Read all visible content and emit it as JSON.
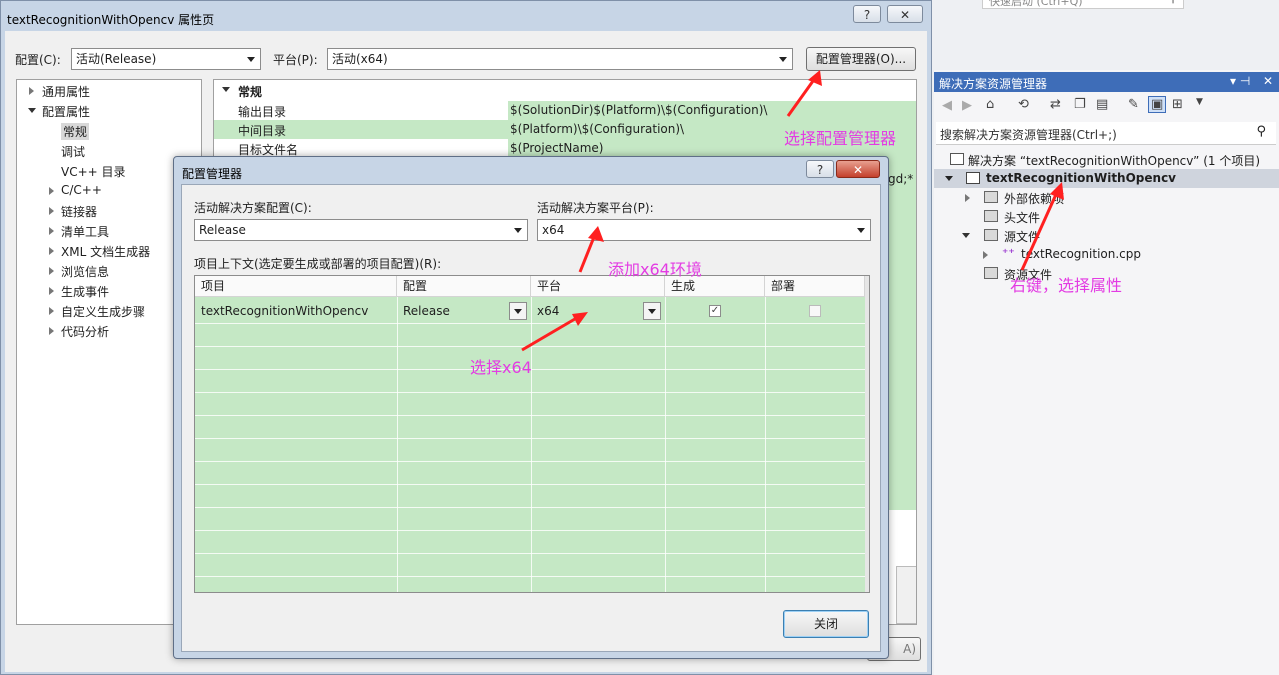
{
  "top_search": {
    "placeholder": "快速启动 (Ctrl+Q)"
  },
  "property_page": {
    "title": "textRecognitionWithOpencv 属性页",
    "help_label": "?",
    "close_label": "✕",
    "config_label": "配置(C):",
    "config_value": "活动(Release)",
    "platform_label": "平台(P):",
    "platform_value": "活动(x64)",
    "config_manager_button": "配置管理器(O)...",
    "bottom_button_partial": "A)",
    "tree": [
      "通用属性",
      "配置属性",
      "常规",
      "调试",
      "VC++ 目录",
      "C/C++",
      "链接器",
      "清单工具",
      "XML 文档生成器",
      "浏览信息",
      "生成事件",
      "自定义生成步骤",
      "代码分析"
    ],
    "section": "常规",
    "rows": [
      {
        "key": "输出目录",
        "value": "$(SolutionDir)$(Platform)\\$(Configuration)\\"
      },
      {
        "key": "中间目录",
        "value": "$(Platform)\\$(Configuration)\\"
      },
      {
        "key": "目标文件名",
        "value": "$(ProjectName)"
      }
    ],
    "partial_value": "gd;*"
  },
  "config_manager": {
    "title": "配置管理器",
    "help_label": "?",
    "close_label": "✕",
    "active_config_label": "活动解决方案配置(C):",
    "active_config_value": "Release",
    "active_platform_label": "活动解决方案平台(P):",
    "active_platform_value": "x64",
    "context_label": "项目上下文(选定要生成或部署的项目配置)(R):",
    "columns": [
      "项目",
      "配置",
      "平台",
      "生成",
      "部署"
    ],
    "rows": [
      {
        "project": "textRecognitionWithOpencv",
        "config": "Release",
        "platform": "x64",
        "build": true,
        "deploy": false
      }
    ],
    "close_button": "关闭"
  },
  "annotations": {
    "select_config_manager": "选择配置管理器",
    "add_x64": "添加x64环境",
    "select_x64": "选择x64",
    "right_click": "右键，选择属性"
  },
  "solution_explorer": {
    "title": "解决方案资源管理器",
    "pin_label": "▾ ⊣",
    "close_label": "✕",
    "search_placeholder": "搜索解决方案资源管理器(Ctrl+;)",
    "solution": "解决方案 “textRecognitionWithOpencv” (1 个项目)",
    "project": "textRecognitionWithOpencv",
    "items": [
      "外部依赖项",
      "头文件",
      "源文件",
      "textRecognition.cpp",
      "资源文件"
    ]
  },
  "colors": {
    "accent": "#3e6db8",
    "highlight": "#c5e8c5",
    "annotation": "#e33be3"
  }
}
